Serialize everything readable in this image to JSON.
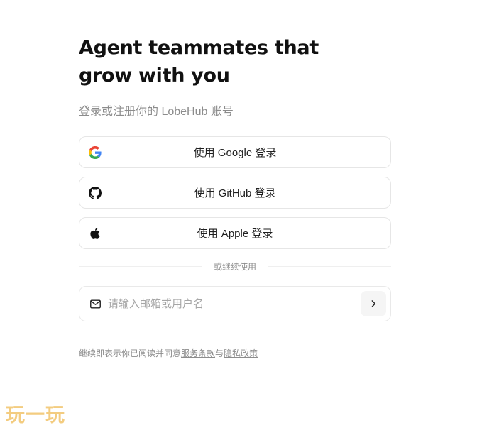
{
  "header": {
    "title": "Agent teammates that grow with you",
    "subtitle": "登录或注册你的 LobeHub 账号"
  },
  "providers": [
    {
      "label": "使用 Google 登录",
      "icon": "google-icon"
    },
    {
      "label": "使用 GitHub 登录",
      "icon": "github-icon"
    },
    {
      "label": "使用 Apple 登录",
      "icon": "apple-icon"
    }
  ],
  "divider": {
    "label": "或继续使用"
  },
  "email": {
    "placeholder": "请输入邮箱或用户名",
    "value": "",
    "icon": "mail-icon",
    "submit_icon": "chevron-right-icon"
  },
  "terms": {
    "prefix": "继续即表示你已阅读并同意",
    "terms_link": "服务条款",
    "conjunction": "与",
    "privacy_link": "隐私政策"
  },
  "watermark": {
    "text": "玩一玩"
  },
  "colors": {
    "border": "#e6e6e6",
    "muted_text": "#8c8c8c",
    "watermark": "#f2c46b"
  }
}
